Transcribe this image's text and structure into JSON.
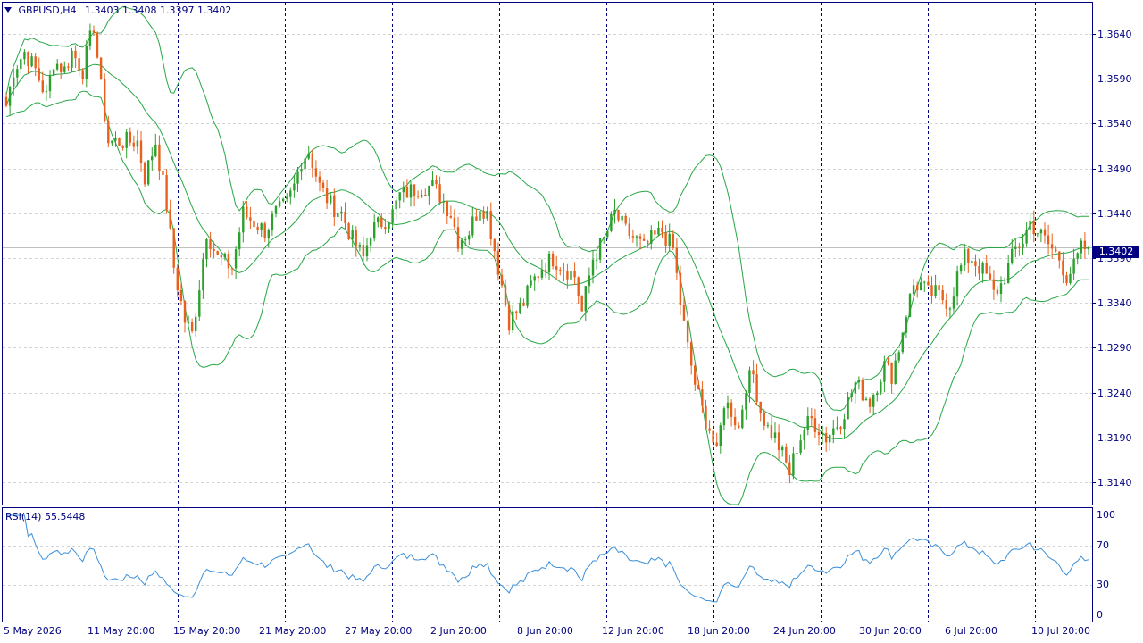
{
  "header": {
    "symbol": "GBPUSD,H4",
    "ohlc": "1.3403 1.3408 1.3397 1.3402"
  },
  "rsi_header": "RSI(14) 55.5448",
  "current_price": "1.3402",
  "colors": {
    "axis": "#000080",
    "bull": "#2ca02c",
    "bear": "#e8601c",
    "bands": "#27a745",
    "rsi": "#3b8fd9",
    "grid": "#d3d3d3",
    "separator": "#000080"
  },
  "chart_data": [
    {
      "type": "candlestick",
      "title": "GBPUSD,H4",
      "indicators": [
        "Bollinger Bands"
      ],
      "ylim": [
        1.3115,
        1.3675
      ],
      "y_ticks": [
        "1.3640",
        "1.3590",
        "1.3540",
        "1.3490",
        "1.3440",
        "1.3390",
        "1.3340",
        "1.3290",
        "1.3240",
        "1.3190",
        "1.3140"
      ],
      "x_ticks": [
        "5 May 2026",
        "11 May 20:00",
        "15 May 20:00",
        "21 May 20:00",
        "27 May 20:00",
        "2 Jun 20:00",
        "8 Jun 20:00",
        "12 Jun 20:00",
        "18 Jun 20:00",
        "24 Jun 20:00",
        "30 Jun 20:00",
        "6 Jul 20:00",
        "10 Jul 20:00"
      ],
      "grid": true,
      "close_anchors": [
        [
          0,
          1.356
        ],
        [
          2,
          1.36
        ],
        [
          5,
          1.362
        ],
        [
          8,
          1.36
        ],
        [
          11,
          1.357
        ],
        [
          13,
          1.361
        ],
        [
          16,
          1.36
        ],
        [
          18,
          1.362
        ],
        [
          21,
          1.36
        ],
        [
          24,
          1.365
        ],
        [
          26,
          1.358
        ],
        [
          28,
          1.352
        ],
        [
          32,
          1.352
        ],
        [
          36,
          1.352
        ],
        [
          38,
          1.348
        ],
        [
          41,
          1.352
        ],
        [
          44,
          1.345
        ],
        [
          46,
          1.338
        ],
        [
          49,
          1.332
        ],
        [
          51,
          1.3305
        ],
        [
          53,
          1.336
        ],
        [
          55,
          1.342
        ],
        [
          58,
          1.339
        ],
        [
          62,
          1.338
        ],
        [
          65,
          1.344
        ],
        [
          68,
          1.343
        ],
        [
          71,
          1.342
        ],
        [
          74,
          1.344
        ],
        [
          77,
          1.345
        ],
        [
          79,
          1.347
        ],
        [
          81,
          1.35
        ],
        [
          83,
          1.351
        ],
        [
          86,
          1.347
        ],
        [
          89,
          1.345
        ],
        [
          92,
          1.344
        ],
        [
          95,
          1.341
        ],
        [
          98,
          1.339
        ],
        [
          100,
          1.342
        ],
        [
          103,
          1.343
        ],
        [
          106,
          1.344
        ],
        [
          108,
          1.346
        ],
        [
          111,
          1.3465
        ],
        [
          114,
          1.347
        ],
        [
          117,
          1.347
        ],
        [
          119,
          1.346
        ],
        [
          122,
          1.344
        ],
        [
          124,
          1.341
        ],
        [
          127,
          1.342
        ],
        [
          130,
          1.345
        ],
        [
          132,
          1.344
        ],
        [
          134,
          1.34
        ],
        [
          136,
          1.336
        ],
        [
          138,
          1.332
        ],
        [
          140,
          1.333
        ],
        [
          142,
          1.334
        ],
        [
          144,
          1.336
        ],
        [
          147,
          1.338
        ],
        [
          150,
          1.339
        ],
        [
          153,
          1.338
        ],
        [
          156,
          1.337
        ],
        [
          158,
          1.333
        ],
        [
          161,
          1.339
        ],
        [
          164,
          1.341
        ],
        [
          167,
          1.344
        ],
        [
          170,
          1.342
        ],
        [
          173,
          1.341
        ],
        [
          175,
          1.34
        ],
        [
          177,
          1.341
        ],
        [
          180,
          1.342
        ],
        [
          183,
          1.34
        ],
        [
          185,
          1.334
        ],
        [
          187,
          1.329
        ],
        [
          189,
          1.325
        ],
        [
          191,
          1.322
        ],
        [
          193,
          1.32
        ],
        [
          195,
          1.317
        ],
        [
          197,
          1.323
        ],
        [
          199,
          1.322
        ],
        [
          201,
          1.32
        ],
        [
          203,
          1.325
        ],
        [
          205,
          1.326
        ],
        [
          207,
          1.322
        ],
        [
          209,
          1.32
        ],
        [
          211,
          1.319
        ],
        [
          213,
          1.317
        ],
        [
          215,
          1.315
        ],
        [
          217,
          1.318
        ],
        [
          219,
          1.32
        ],
        [
          221,
          1.321
        ],
        [
          223,
          1.32
        ],
        [
          225,
          1.319
        ],
        [
          227,
          1.32
        ],
        [
          229,
          1.321
        ],
        [
          231,
          1.323
        ],
        [
          233,
          1.325
        ],
        [
          235,
          1.324
        ],
        [
          237,
          1.323
        ],
        [
          239,
          1.325
        ],
        [
          241,
          1.327
        ],
        [
          243,
          1.326
        ],
        [
          245,
          1.329
        ],
        [
          247,
          1.333
        ],
        [
          249,
          1.336
        ],
        [
          251,
          1.336
        ],
        [
          253,
          1.335
        ],
        [
          255,
          1.335
        ],
        [
          257,
          1.3345
        ],
        [
          259,
          1.334
        ],
        [
          261,
          1.337
        ],
        [
          263,
          1.339
        ],
        [
          265,
          1.339
        ],
        [
          267,
          1.338
        ],
        [
          269,
          1.337
        ],
        [
          271,
          1.335
        ],
        [
          273,
          1.336
        ],
        [
          275,
          1.338
        ],
        [
          277,
          1.34
        ],
        [
          279,
          1.341
        ],
        [
          281,
          1.343
        ],
        [
          283,
          1.342
        ],
        [
          285,
          1.341
        ],
        [
          287,
          1.34
        ],
        [
          289,
          1.339
        ],
        [
          291,
          1.337
        ],
        [
          293,
          1.338
        ],
        [
          295,
          1.34
        ],
        [
          297,
          1.3402
        ]
      ]
    },
    {
      "type": "line",
      "title": "RSI(14) 55.5448",
      "ylim": [
        0,
        100
      ],
      "y_ticks": [
        "100",
        "70",
        "30",
        "0"
      ],
      "levels": [
        70,
        30
      ],
      "current_value": 55.5448
    }
  ]
}
